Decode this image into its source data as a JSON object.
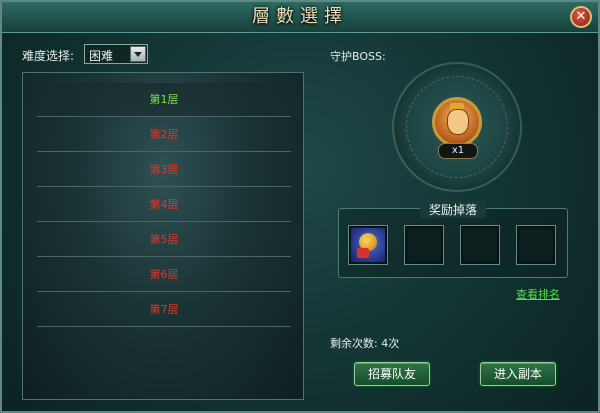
{
  "window": {
    "title": "層數選擇",
    "close_label": "✕"
  },
  "difficulty": {
    "label": "难度选择:",
    "selected": "困难"
  },
  "floors": [
    {
      "label": "第1层",
      "state": "active"
    },
    {
      "label": "第2层",
      "state": "locked"
    },
    {
      "label": "第3层",
      "state": "locked"
    },
    {
      "label": "第4层",
      "state": "locked"
    },
    {
      "label": "第5层",
      "state": "locked"
    },
    {
      "label": "第6层",
      "state": "locked"
    },
    {
      "label": "第7层",
      "state": "locked"
    }
  ],
  "boss": {
    "label": "守护BOSS:",
    "count": "x1",
    "icon": "boss-portrait-icon"
  },
  "rewards": {
    "title": "奖励掉落",
    "slots": [
      "reward-item-icon",
      "",
      "",
      ""
    ]
  },
  "rank_link": "查看排名",
  "remaining": {
    "label": "剩余次数:",
    "value": "4次"
  },
  "buttons": {
    "recruit": "招募队友",
    "enter": "进入副本"
  },
  "colors": {
    "active_floor": "#7de053",
    "locked_floor": "#e2352a",
    "link": "#4fe04a"
  }
}
